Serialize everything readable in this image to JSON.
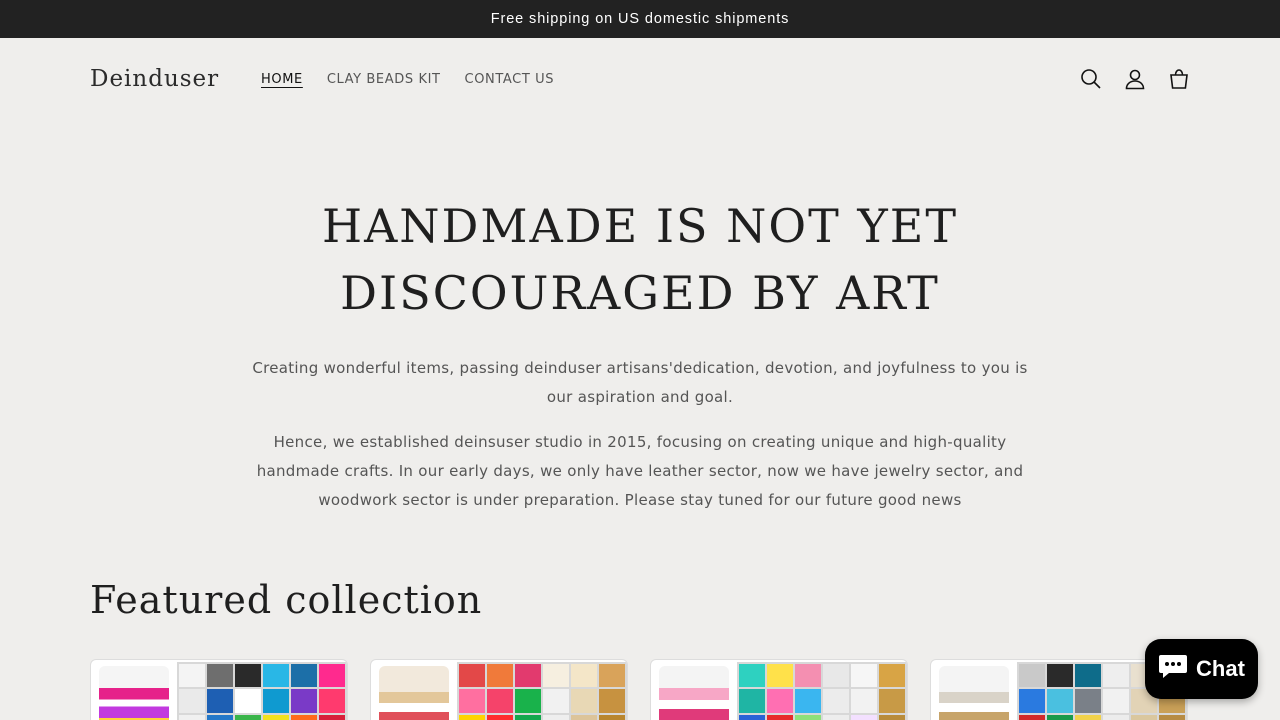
{
  "announcement": "Free shipping on US domestic shipments",
  "brand": "Deinduser",
  "nav": [
    "HOME",
    "CLAY BEADS KIT",
    "CONTACT US"
  ],
  "header_icons": [
    "search-icon",
    "account-icon",
    "cart-icon"
  ],
  "hero": {
    "title_line1": "HANDMADE IS NOT YET",
    "title_line2": "DISCOURAGED BY ART",
    "paragraph1": "Creating wonderful items, passing deinduser artisans'dedication, devotion, and joyfulness to you is our aspiration and goal.",
    "paragraph2": "Hence, we established deinsuser studio in 2015, focusing on creating unique and high-quality handmade crafts. In our early days, we only have leather sector, now we have jewelry sector, and woodwork sector is under preparation. Please stay tuned for our future good news"
  },
  "featured": {
    "title": "Featured collection"
  },
  "chat": {
    "label": "Chat"
  },
  "colors": {
    "announcement_bg": "#222222",
    "page_bg": "#efeeec",
    "chat_bg": "#000000"
  }
}
